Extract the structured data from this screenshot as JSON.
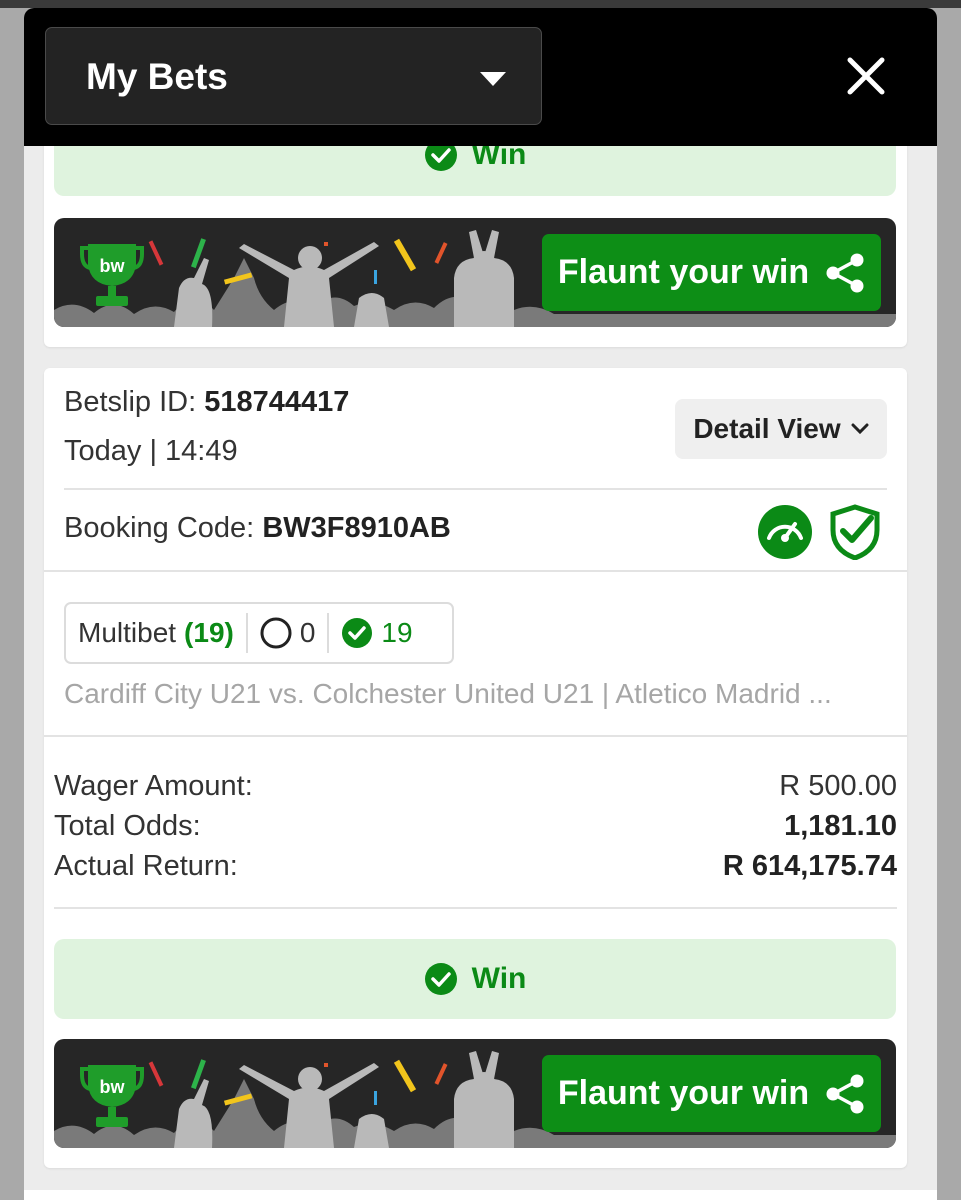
{
  "header": {
    "title": "My Bets"
  },
  "card_top": {
    "status": "Win",
    "flaunt_label": "Flaunt your win",
    "brand_logo": "bw"
  },
  "bet": {
    "betslip_label": "Betslip ID:",
    "betslip_id": "518744417",
    "datetime": "Today | 14:49",
    "detail_view_label": "Detail View",
    "booking_label": "Booking Code:",
    "booking_code": "BW3F8910AB",
    "multibet_label": "Multibet",
    "multibet_count": "(19)",
    "open_count": "0",
    "won_count": "19",
    "events": "Cardiff City U21 vs. Colchester United U21 | Atletico Madrid ...",
    "wager_label": "Wager Amount:",
    "wager_value": "R 500.00",
    "odds_label": "Total Odds:",
    "odds_value": "1,181.10",
    "return_label": "Actual Return:",
    "return_value": "R 614,175.74",
    "status": "Win",
    "flaunt_label": "Flaunt your win",
    "brand_logo": "bw"
  },
  "colors": {
    "brand_green": "#0d8e16",
    "win_bg": "#dff3de",
    "header_bg": "#000000"
  }
}
